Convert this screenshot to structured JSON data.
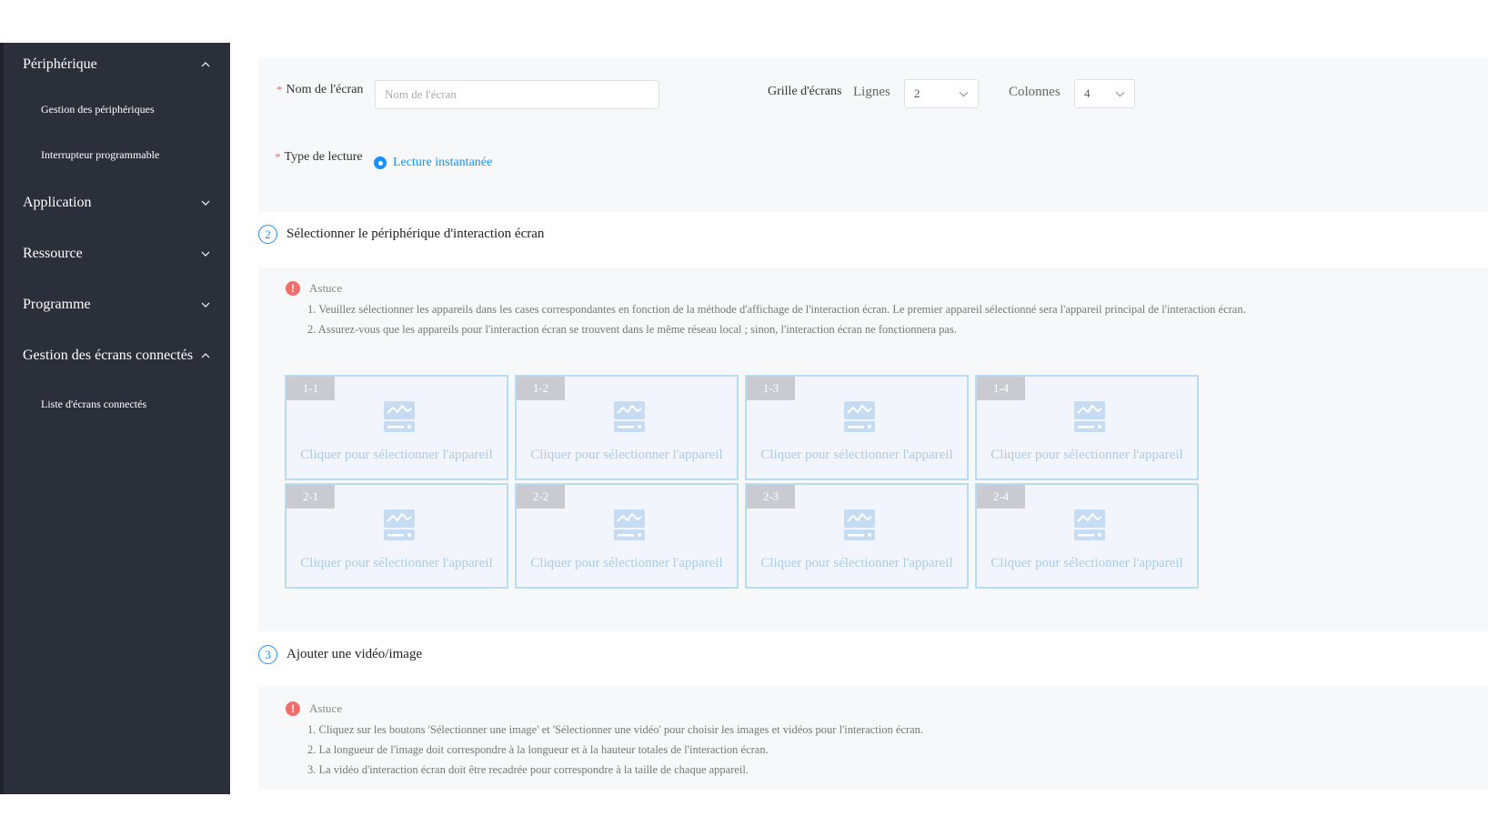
{
  "sidebar": {
    "groups": [
      {
        "label": "Périphérique",
        "expanded": true,
        "items": [
          "Gestion des périphériques",
          "Interrupteur programmable"
        ]
      },
      {
        "label": "Application",
        "expanded": false,
        "items": []
      },
      {
        "label": "Ressource",
        "expanded": false,
        "items": []
      },
      {
        "label": "Programme",
        "expanded": false,
        "items": []
      },
      {
        "label": "Gestion des écrans connectés",
        "expanded": true,
        "items": [
          "Liste d'écrans connectés"
        ]
      }
    ]
  },
  "form": {
    "screen_name_label": "Nom de l'écran",
    "screen_name_placeholder": "Nom de l'écran",
    "screen_name_value": "",
    "grid_label": "Grille d'écrans",
    "rows_label": "Lignes",
    "rows_value": "2",
    "cols_label": "Colonnes",
    "cols_value": "4",
    "play_type_label": "Type de lecture",
    "play_type_option": "Lecture instantanée"
  },
  "step2": {
    "number": "2",
    "title": "Sélectionner le périphérique d'interaction écran",
    "tip_title": "Astuce",
    "tips": [
      "1. Veuillez sélectionner les appareils dans les cases correspondantes en fonction de la méthode d'affichage de l'interaction écran. Le premier appareil sélectionné sera l'appareil principal de l'interaction écran.",
      "2. Assurez-vous que les appareils pour l'interaction écran se trouvent dans le même réseau local ; sinon, l'interaction écran ne fonctionnera pas."
    ],
    "cells": [
      {
        "tag": "1-1",
        "text": "Cliquer pour sélectionner l'appareil"
      },
      {
        "tag": "1-2",
        "text": "Cliquer pour sélectionner l'appareil"
      },
      {
        "tag": "1-3",
        "text": "Cliquer pour sélectionner l'appareil"
      },
      {
        "tag": "1-4",
        "text": "Cliquer pour sélectionner l'appareil"
      },
      {
        "tag": "2-1",
        "text": "Cliquer pour sélectionner l'appareil"
      },
      {
        "tag": "2-2",
        "text": "Cliquer pour sélectionner l'appareil"
      },
      {
        "tag": "2-3",
        "text": "Cliquer pour sélectionner l'appareil"
      },
      {
        "tag": "2-4",
        "text": "Cliquer pour sélectionner l'appareil"
      }
    ]
  },
  "step3": {
    "number": "3",
    "title": "Ajouter une vidéo/image",
    "tip_title": "Astuce",
    "tips": [
      "1. Cliquez sur les boutons 'Sélectionner une image' et 'Sélectionner une vidéo' pour choisir les images et vidéos pour l'interaction écran.",
      "2. La longueur de l'image doit correspondre à la longueur et à la hauteur totales de l'interaction écran.",
      "3. La vidéo d'interaction écran doit être recadrée pour correspondre à la taille de chaque appareil."
    ]
  },
  "colors": {
    "sidebar_bg": "#2b2f3a",
    "accent": "#1890ff",
    "required": "#f56c6c",
    "cell_border": "#b9dcf2"
  },
  "icons": [
    "chevron-up-icon",
    "chevron-down-icon",
    "warning-icon",
    "device-icon"
  ]
}
